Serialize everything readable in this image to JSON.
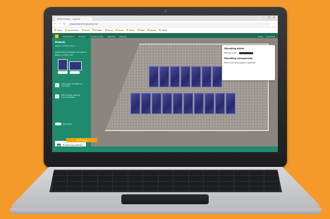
{
  "browser": {
    "tab_title": "PVSol Online - Layout",
    "url": "www.solarsim.app/planner",
    "controls": [
      "–",
      "□",
      "×"
    ],
    "bookmarks": [
      "Apps",
      "Bookmark",
      "Links",
      "Folder",
      "Docs",
      "Tools",
      "Shop",
      "Mail",
      "News",
      "Other"
    ]
  },
  "app_nav": {
    "items": [
      "Dashboard",
      "Project",
      "Components",
      "Results",
      "Report"
    ],
    "right_items": [
      "Help",
      "Account"
    ]
  },
  "left_panel": {
    "title": "Module",
    "subtitle": "Panel configuration",
    "heading": "Select the modules and place them on the roof",
    "rows": [
      "Auto-place modules on roof area",
      "Edit module spacing and orientation"
    ],
    "toggle_label": "Show grid",
    "card_label": "Module type selected"
  },
  "info_box": {
    "title": "Mounting plane",
    "row_label": "Module rows",
    "subtitle": "Mounting components",
    "note": "Roof mounting system selected"
  },
  "cta": {
    "label": "Next step"
  },
  "colors": {
    "background": "#f59a2a",
    "app_green": "#1f8a6c",
    "nav_green": "#1e6b53",
    "panel_blue": "#292a6b",
    "cta_orange": "#f0a500"
  }
}
